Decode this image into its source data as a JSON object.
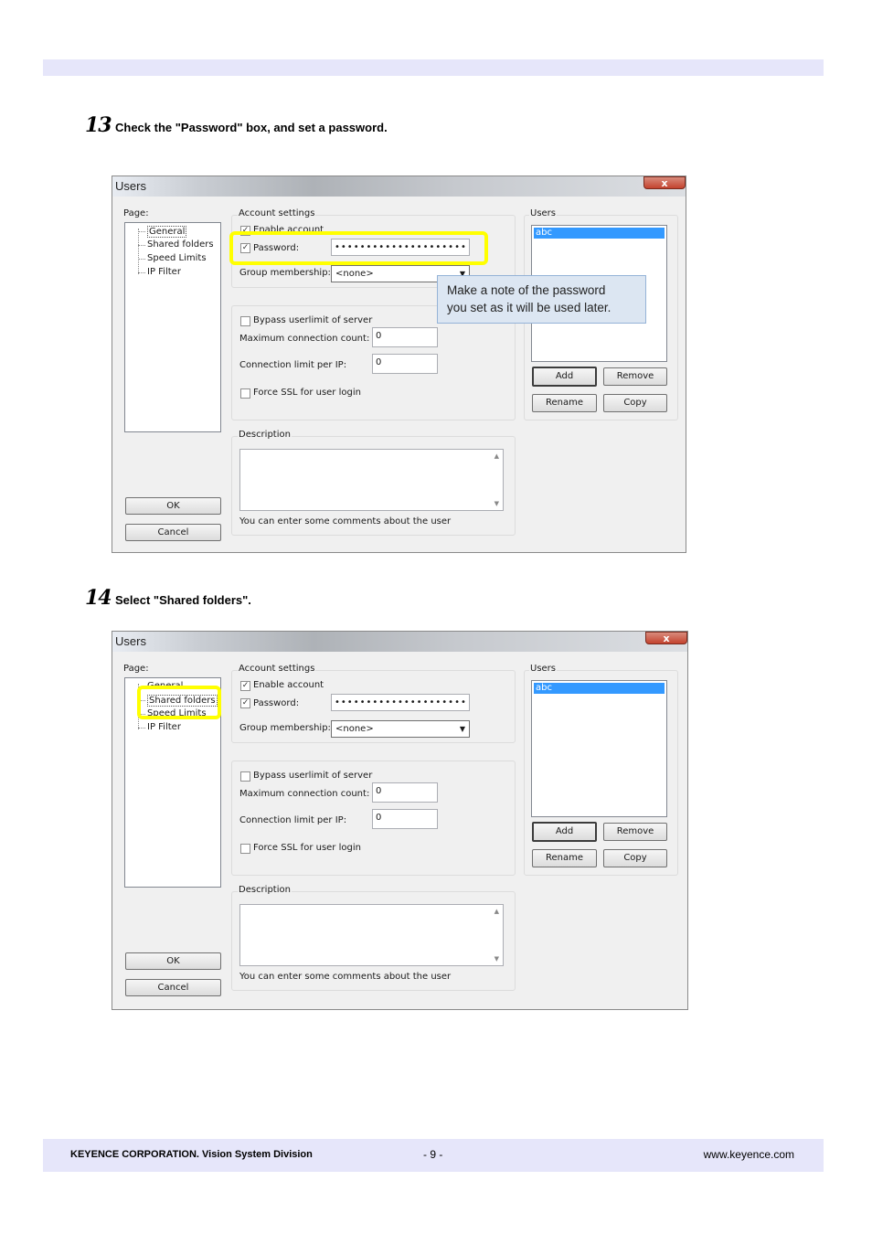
{
  "steps": [
    {
      "number": "13",
      "instruction": "Check the \"Password\" box, and set a password."
    },
    {
      "number": "14",
      "instruction": "Select \"Shared folders\"."
    }
  ],
  "dialog": {
    "title": "Users",
    "close": "x",
    "page_label": "Page:",
    "pages": [
      "General",
      "Shared folders",
      "Speed Limits",
      "IP Filter"
    ],
    "account_settings_label": "Account settings",
    "enable_account_label": "Enable account",
    "password_label": "Password:",
    "password_value": "•••••••••••••••••••••",
    "group_membership_label": "Group membership:",
    "group_membership_value": "<none>",
    "bypass_label": "Bypass userlimit of server",
    "max_conn_label": "Maximum connection count:",
    "max_conn_value": "0",
    "conn_limit_label": "Connection limit per IP:",
    "conn_limit_value": "0",
    "force_ssl_label": "Force SSL for user login",
    "description_label": "Description",
    "description_hint": "You can enter some comments about the user",
    "users_label": "Users",
    "users": [
      "abc"
    ],
    "add_label": "Add",
    "remove_label": "Remove",
    "rename_label": "Rename",
    "copy_label": "Copy",
    "ok_label": "OK",
    "cancel_label": "Cancel"
  },
  "callout": {
    "line1": "Make a note of the password",
    "line2": "you set as it will be used later."
  },
  "footer": {
    "company": "KEYENCE CORPORATION. Vision System Division",
    "page": "- 9 -",
    "website": "www.keyence.com"
  },
  "colors": {
    "band": "#e6e6fa",
    "highlight": "#ffff00",
    "callout_bg": "#dce6f2",
    "selection": "#3399ff"
  }
}
